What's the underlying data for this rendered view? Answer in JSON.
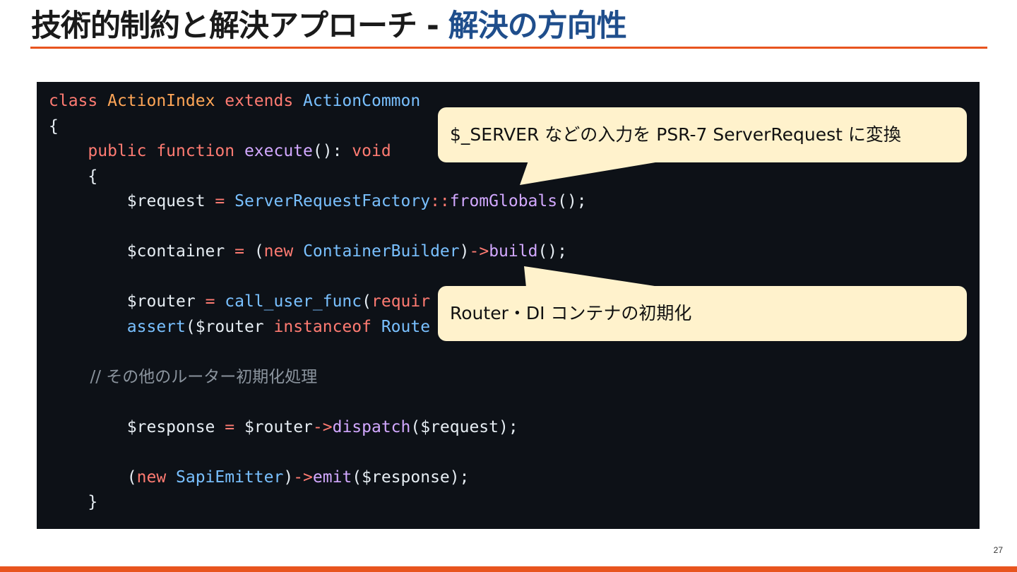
{
  "slide": {
    "title_main": "技術的制約と解決アプローチ - ",
    "title_accent": "解決の方向性",
    "page_number": "27",
    "colors": {
      "accent_rule": "#e8541e",
      "title_accent": "#1f4e8c",
      "code_background": "#0d1117",
      "callout_background": "#fff2cc"
    }
  },
  "code": {
    "language": "php",
    "lines": [
      [
        {
          "t": "class ",
          "c": "kw"
        },
        {
          "t": "ActionIndex ",
          "c": "ty"
        },
        {
          "t": "extends ",
          "c": "kw"
        },
        {
          "t": "ActionCommon",
          "c": "cls"
        }
      ],
      [
        {
          "t": "{",
          "c": ""
        }
      ],
      [
        {
          "t": "    ",
          "c": ""
        },
        {
          "t": "public ",
          "c": "kw"
        },
        {
          "t": "function ",
          "c": "kw"
        },
        {
          "t": "execute",
          "c": "fn"
        },
        {
          "t": "(): ",
          "c": ""
        },
        {
          "t": "void",
          "c": "kw"
        }
      ],
      [
        {
          "t": "    {",
          "c": ""
        }
      ],
      [
        {
          "t": "        $request ",
          "c": ""
        },
        {
          "t": "= ",
          "c": "op"
        },
        {
          "t": "ServerRequestFactory",
          "c": "cls"
        },
        {
          "t": "::",
          "c": "op"
        },
        {
          "t": "fromGlobals",
          "c": "fn"
        },
        {
          "t": "();",
          "c": ""
        }
      ],
      [],
      [
        {
          "t": "        $container ",
          "c": ""
        },
        {
          "t": "= ",
          "c": "op"
        },
        {
          "t": "(",
          "c": ""
        },
        {
          "t": "new ",
          "c": "kw"
        },
        {
          "t": "ContainerBuilder",
          "c": "cls"
        },
        {
          "t": ")",
          "c": ""
        },
        {
          "t": "->",
          "c": "op"
        },
        {
          "t": "build",
          "c": "fn"
        },
        {
          "t": "();",
          "c": ""
        }
      ],
      [],
      [
        {
          "t": "        $router ",
          "c": ""
        },
        {
          "t": "= ",
          "c": "op"
        },
        {
          "t": "call_user_func",
          "c": "cls"
        },
        {
          "t": "(",
          "c": ""
        },
        {
          "t": "requir",
          "c": "kw"
        }
      ],
      [
        {
          "t": "        ",
          "c": ""
        },
        {
          "t": "assert",
          "c": "cls"
        },
        {
          "t": "($router ",
          "c": ""
        },
        {
          "t": "instanceof ",
          "c": "kw"
        },
        {
          "t": "Route",
          "c": "cls"
        }
      ],
      [],
      [
        {
          "t": "        // その他のルーター初期化処理",
          "c": "cm"
        }
      ],
      [],
      [
        {
          "t": "        $response ",
          "c": ""
        },
        {
          "t": "= ",
          "c": "op"
        },
        {
          "t": "$router",
          "c": ""
        },
        {
          "t": "->",
          "c": "op"
        },
        {
          "t": "dispatch",
          "c": "fn"
        },
        {
          "t": "($request);",
          "c": ""
        }
      ],
      [],
      [
        {
          "t": "        (",
          "c": ""
        },
        {
          "t": "new ",
          "c": "kw"
        },
        {
          "t": "SapiEmitter",
          "c": "cls"
        },
        {
          "t": ")",
          "c": ""
        },
        {
          "t": "->",
          "c": "op"
        },
        {
          "t": "emit",
          "c": "fn"
        },
        {
          "t": "($response);",
          "c": ""
        }
      ],
      [
        {
          "t": "    }",
          "c": ""
        }
      ]
    ]
  },
  "callouts": [
    {
      "text": "$_SERVER などの入力を PSR-7 ServerRequest に変換"
    },
    {
      "text": "Router・DI コンテナの初期化"
    }
  ]
}
